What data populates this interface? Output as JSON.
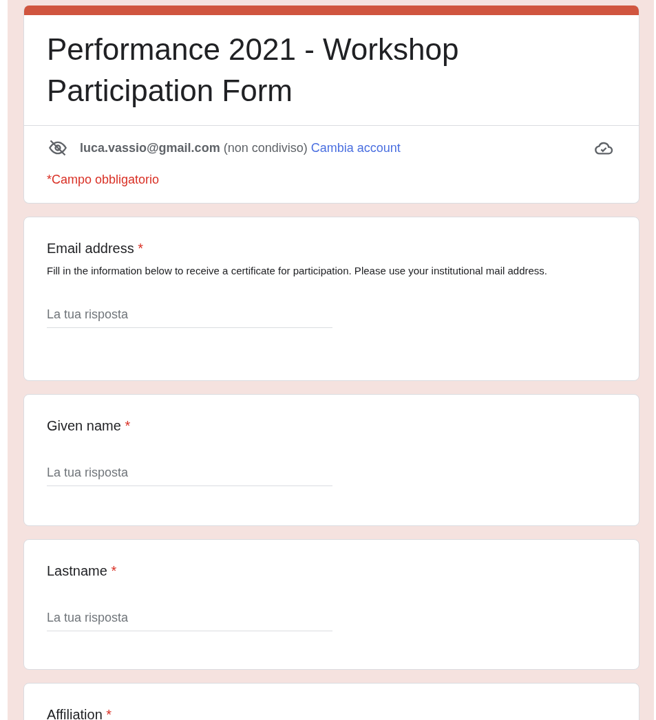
{
  "form": {
    "title": "Performance 2021 - Workshop Participation Form",
    "account": {
      "email": "luca.vassio@gmail.com",
      "note": "(non condiviso)",
      "switch_link": "Cambia account"
    },
    "required_note": "*Campo obbligatorio"
  },
  "questions": [
    {
      "label": "Email address",
      "required": true,
      "required_mark": "*",
      "description": "Fill in the information below to receive a certificate for participation. Please use your institutional mail address.",
      "placeholder": "La tua risposta"
    },
    {
      "label": "Given name",
      "required": true,
      "required_mark": "*",
      "placeholder": "La tua risposta"
    },
    {
      "label": "Lastname",
      "required": true,
      "required_mark": "*",
      "placeholder": "La tua risposta"
    },
    {
      "label": "Affiliation",
      "required": true,
      "required_mark": "*"
    }
  ]
}
